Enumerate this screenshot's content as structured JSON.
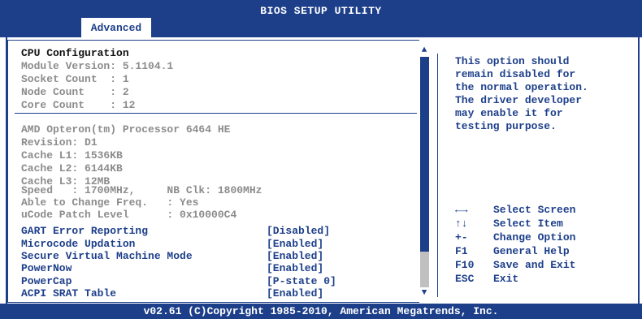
{
  "header": {
    "title": "BIOS SETUP UTILITY",
    "tab": "Advanced"
  },
  "info_top": [
    "CPU Configuration",
    "Module Version: 5.1104.1",
    "Socket Count  : 1",
    "Node Count    : 2",
    "Core Count    : 12"
  ],
  "info_cpu": [
    "AMD Opteron(tm) Processor 6464 HE",
    "Revision: D1",
    "Cache L1: 1536KB",
    "Cache L2: 6144KB",
    "Cache L3: 12MB",
    "Speed   : 1700MHz,     NB Clk: 1800MHz",
    "Able to Change Freq.   : Yes",
    "uCode Patch Level      : 0x10000C4"
  ],
  "settings": [
    {
      "label": "GART Error Reporting",
      "value": "[Disabled]"
    },
    {
      "label": "Microcode Updation",
      "value": "[Enabled]"
    },
    {
      "label": "Secure Virtual Machine Mode",
      "value": "[Enabled]"
    },
    {
      "label": "PowerNow",
      "value": "[Enabled]"
    },
    {
      "label": "PowerCap",
      "value": "[P-state 0]"
    },
    {
      "label": "ACPI SRAT Table",
      "value": "[Enabled]"
    }
  ],
  "help_text": "This option should\nremain disabled for\nthe normal operation.\nThe driver developer\nmay enable it for\ntesting purpose.",
  "key_help": [
    {
      "key": "←→",
      "desc": "Select Screen"
    },
    {
      "key": "↑↓",
      "desc": "Select Item"
    },
    {
      "key": "+-",
      "desc": "Change Option"
    },
    {
      "key": "F1",
      "desc": "General Help"
    },
    {
      "key": "F10",
      "desc": "Save and Exit"
    },
    {
      "key": "ESC",
      "desc": "Exit"
    }
  ],
  "footer": "v02.61 (C)Copyright 1985-2010, American Megatrends, Inc.",
  "colors": {
    "accent": "#1d3f8a",
    "dim_text": "#8c8c8c",
    "background": "#ffffff"
  }
}
